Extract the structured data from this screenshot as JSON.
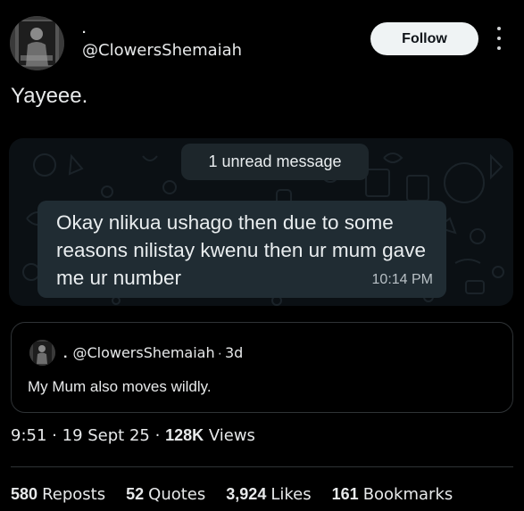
{
  "author": {
    "display_name": ".",
    "handle": "@ClowersShemaiah",
    "avatar_icon": "person-photo-avatar"
  },
  "follow_label": "Follow",
  "post_text": "Yayeee.",
  "chat_screenshot": {
    "unread_label": "1 unread message",
    "message_text": "Okay nlikua ushago then due to some reasons nilistay kwenu then ur mum gave me ur number",
    "message_time": "10:14 PM",
    "background_color": "#0b1014",
    "bubble_color": "#202c33"
  },
  "quoted_post": {
    "display_name": ".",
    "handle": "@ClowersShemaiah",
    "separator": "·",
    "age": "3d",
    "text": "My Mum also moves wildly."
  },
  "meta": {
    "time": "9:51",
    "separator": "·",
    "date": "19 Sept 25",
    "views_count": "128K",
    "views_label": "Views"
  },
  "stats": {
    "reposts_count": "580",
    "reposts_label": "Reposts",
    "quotes_count": "52",
    "quotes_label": "Quotes",
    "likes_count": "3,924",
    "likes_label": "Likes",
    "bookmarks_count": "161",
    "bookmarks_label": "Bookmarks"
  },
  "colors": {
    "background": "#000000",
    "text": "#e7e9ea",
    "border": "#2f3336",
    "follow_bg": "#eff3f4"
  }
}
